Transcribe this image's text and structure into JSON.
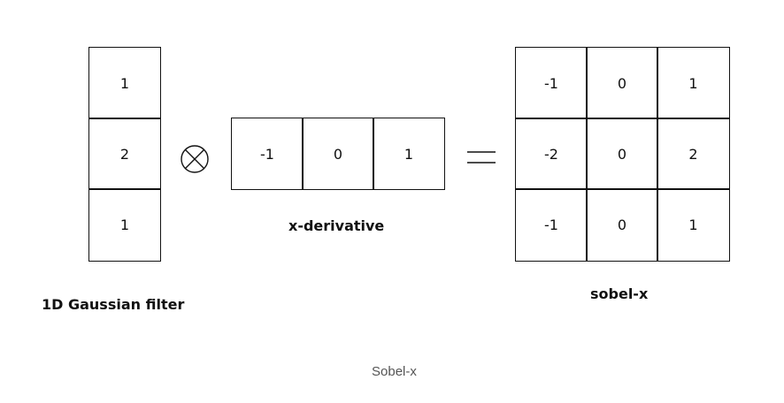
{
  "gaussian": {
    "values": [
      "1",
      "2",
      "1"
    ],
    "label": "1D Gaussian filter"
  },
  "derivative": {
    "values": [
      "-1",
      "0",
      "1"
    ],
    "label": "x-derivative"
  },
  "sobel": {
    "values": [
      [
        "-1",
        "0",
        "1"
      ],
      [
        "-2",
        "0",
        "2"
      ],
      [
        "-1",
        "0",
        "1"
      ]
    ],
    "label": "sobel-x"
  },
  "operators": {
    "convolution": "⊗",
    "equals": "="
  },
  "caption": "Sobel-x"
}
